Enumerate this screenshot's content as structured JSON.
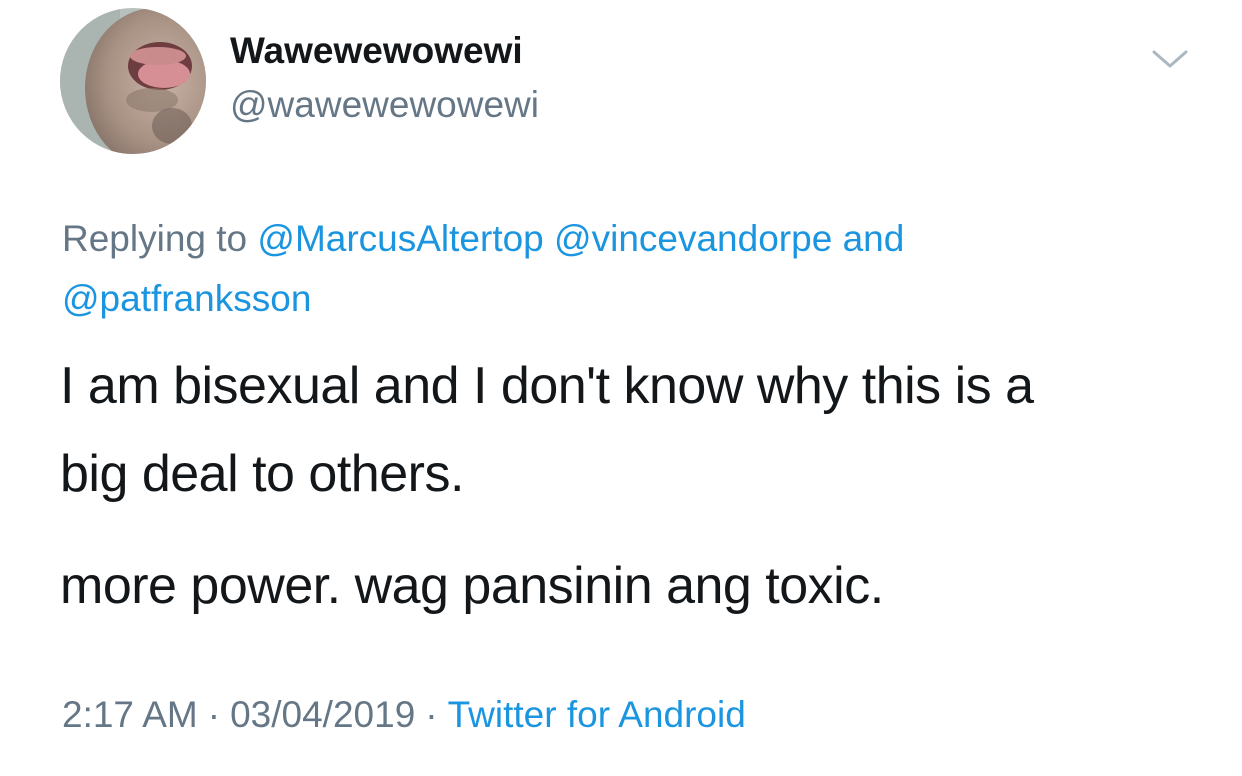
{
  "user": {
    "display_name": "Wawewewowewi",
    "handle": "@wawewewowewi",
    "avatar_icon": "profile-photo"
  },
  "menu": {
    "icon": "chevron-down-icon"
  },
  "reply": {
    "prefix": "Replying to",
    "mentions": [
      "@MarcusAltertop",
      "@vincevandorpe",
      "@patfranksson"
    ],
    "conjunction": "and"
  },
  "body": {
    "line1": "I am bisexual and I don't know why this is a",
    "line2": "big deal to others.",
    "line3": "more power. wag pansinin ang toxic."
  },
  "meta": {
    "time": "2:17 AM",
    "separator": "·",
    "date": "03/04/2019",
    "source": "Twitter for Android"
  },
  "colors": {
    "text": "#14171a",
    "muted": "#657786",
    "link": "#1b95e0"
  }
}
